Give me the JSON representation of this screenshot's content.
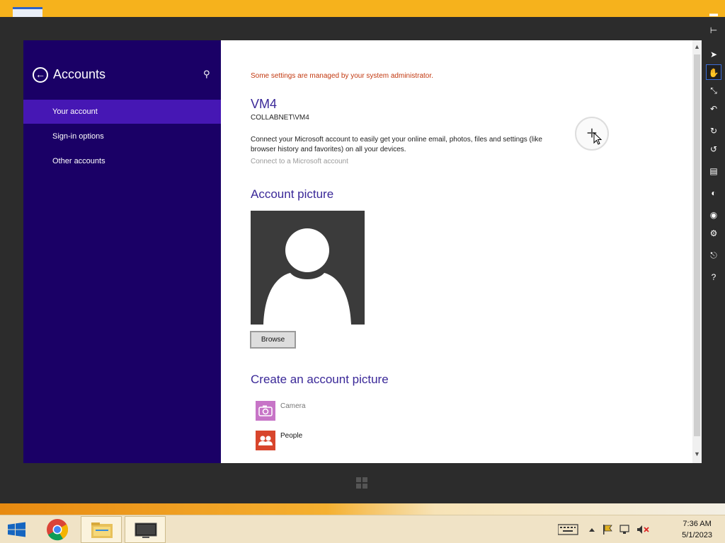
{
  "nav": {
    "title": "Accounts",
    "items": [
      {
        "label": "Your account"
      },
      {
        "label": "Sign-in options"
      },
      {
        "label": "Other accounts"
      }
    ]
  },
  "content": {
    "admin_note": "Some settings are managed by your system administrator.",
    "account_name": "VM4",
    "account_domain": "COLLABNET\\VM4",
    "connect_description": "Connect your Microsoft account to easily get your online email, photos, files and settings (like browser history and favorites) on all your devices.",
    "connect_link": "Connect to a Microsoft account",
    "picture_title": "Account picture",
    "browse_label": "Browse",
    "create_title": "Create an account picture",
    "apps": [
      {
        "label": "Camera",
        "color": "#c774c7",
        "icon": "camera-icon"
      },
      {
        "label": "People",
        "color": "#d8452c",
        "icon": "people-icon"
      }
    ]
  },
  "taskbar": {
    "apps": [
      "start-button",
      "chrome-icon",
      "file-explorer-icon",
      "remote-desktop-icon"
    ],
    "time": "7:36 AM",
    "date": "5/1/2023"
  },
  "colors": {
    "nav_bg": "#1a0066",
    "nav_selected": "#4617b4",
    "accent_text": "#3a2898",
    "admin_note": "#c2380f"
  }
}
